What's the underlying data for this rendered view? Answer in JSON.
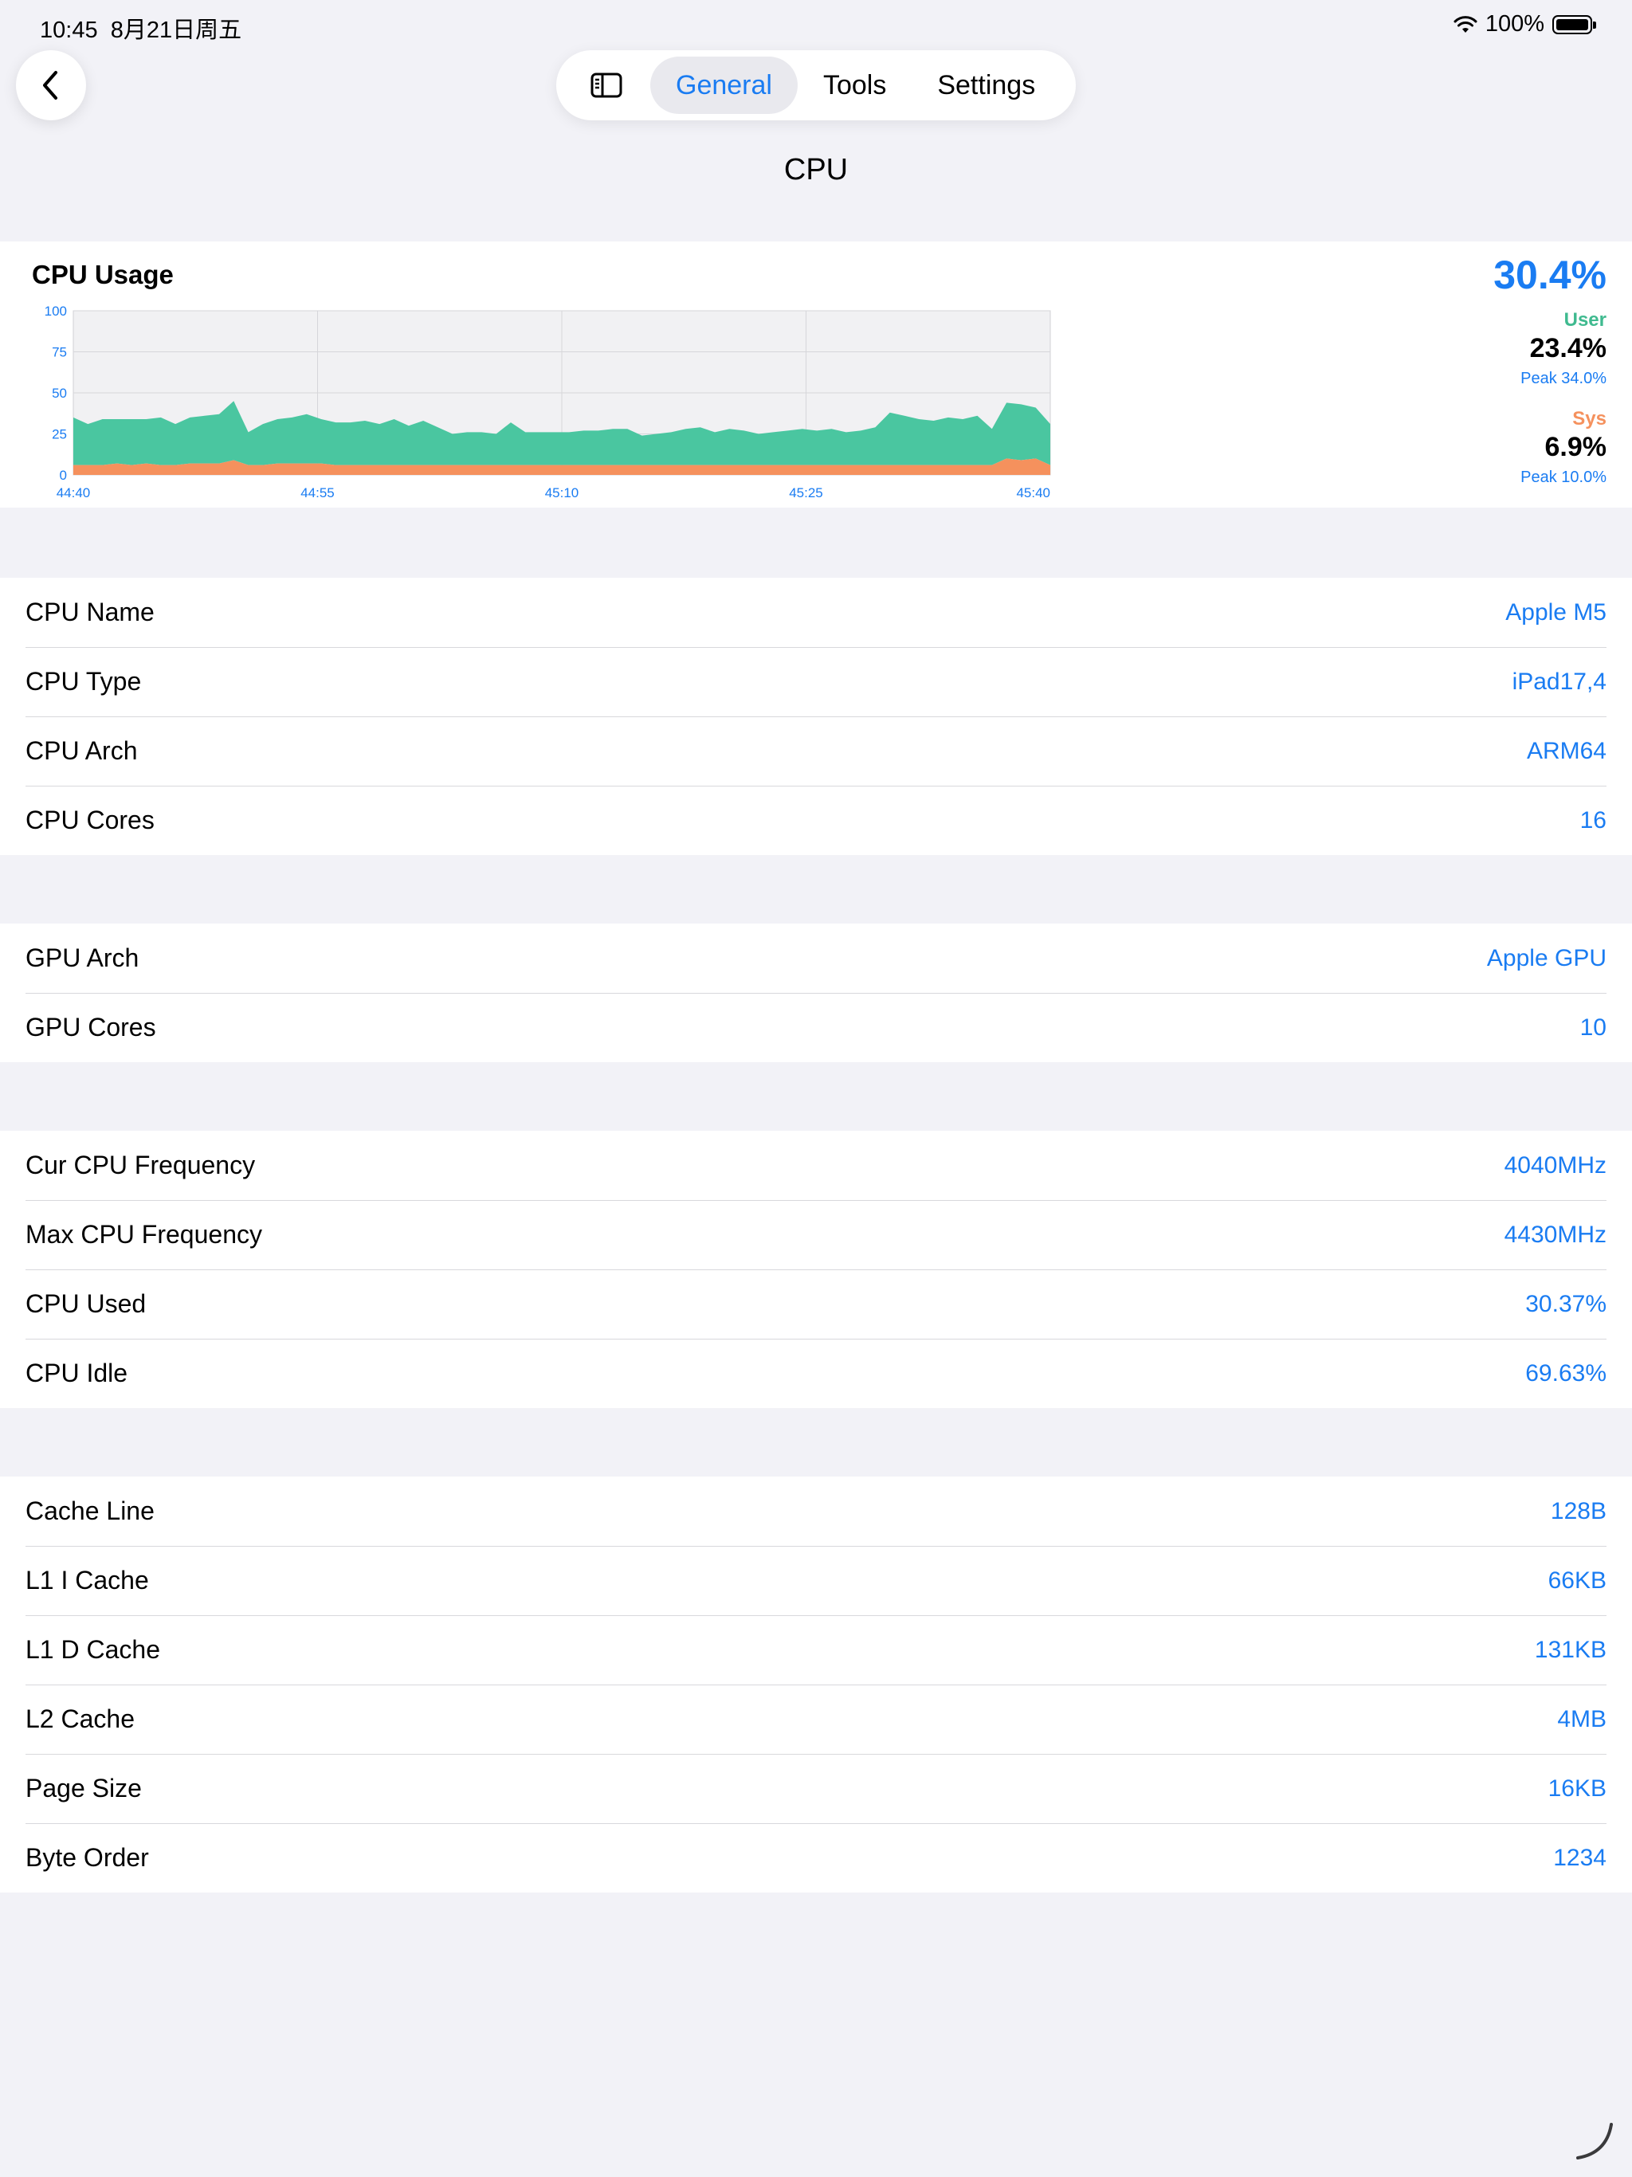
{
  "status_bar": {
    "time": "10:45",
    "date": "8月21日周五",
    "battery": "100%"
  },
  "nav": {
    "tabs": [
      {
        "label": "General",
        "active": true
      },
      {
        "label": "Tools",
        "active": false
      },
      {
        "label": "Settings",
        "active": false
      }
    ]
  },
  "page_title": "CPU",
  "cpu_usage": {
    "title": "CPU Usage",
    "total": "30.4%",
    "user_label": "User",
    "user_value": "23.4%",
    "user_peak": "Peak  34.0%",
    "sys_label": "Sys",
    "sys_value": "6.9%",
    "sys_peak": "Peak  10.0%"
  },
  "chart_data": {
    "type": "area",
    "stacked": true,
    "y_ticks": [
      "100",
      "75",
      "50",
      "25",
      "0"
    ],
    "ylim": [
      0,
      100
    ],
    "x_ticks": [
      "44:40",
      "44:55",
      "45:10",
      "45:25",
      "45:40"
    ],
    "grid": true,
    "series": [
      {
        "name": "User",
        "color": "#4ac6a0",
        "values": [
          29,
          25,
          28,
          27,
          28,
          27,
          29,
          25,
          28,
          29,
          30,
          36,
          20,
          25,
          27,
          28,
          30,
          27,
          26,
          26,
          27,
          25,
          28,
          24,
          27,
          23,
          19,
          20,
          20,
          19,
          26,
          20,
          20,
          20,
          20,
          21,
          21,
          22,
          22,
          18,
          19,
          20,
          22,
          23,
          20,
          22,
          21,
          19,
          20,
          21,
          22,
          21,
          22,
          20,
          21,
          23,
          32,
          30,
          28,
          27,
          29,
          28,
          30,
          22,
          34,
          34,
          31,
          25
        ]
      },
      {
        "name": "Sys",
        "color": "#f5915d",
        "values": [
          6,
          6,
          6,
          7,
          6,
          7,
          6,
          6,
          7,
          7,
          7,
          9,
          6,
          6,
          7,
          7,
          7,
          7,
          6,
          6,
          6,
          6,
          6,
          6,
          6,
          6,
          6,
          6,
          6,
          6,
          6,
          6,
          6,
          6,
          6,
          6,
          6,
          6,
          6,
          6,
          6,
          6,
          6,
          6,
          6,
          6,
          6,
          6,
          6,
          6,
          6,
          6,
          6,
          6,
          6,
          6,
          6,
          6,
          6,
          6,
          6,
          6,
          6,
          6,
          10,
          9,
          10,
          6
        ]
      }
    ]
  },
  "cpu_info": [
    {
      "label": "CPU Name",
      "value": "Apple M5"
    },
    {
      "label": "CPU Type",
      "value": "iPad17,4"
    },
    {
      "label": "CPU Arch",
      "value": "ARM64"
    },
    {
      "label": "CPU Cores",
      "value": "16"
    }
  ],
  "gpu_info": [
    {
      "label": "GPU Arch",
      "value": "Apple GPU"
    },
    {
      "label": "GPU Cores",
      "value": "10"
    }
  ],
  "freq_info": [
    {
      "label": "Cur CPU Frequency",
      "value": "4040MHz"
    },
    {
      "label": "Max CPU Frequency",
      "value": "4430MHz"
    },
    {
      "label": "CPU Used",
      "value": "30.37%"
    },
    {
      "label": "CPU Idle",
      "value": "69.63%"
    }
  ],
  "cache_info": [
    {
      "label": "Cache Line",
      "value": "128B"
    },
    {
      "label": "L1 I Cache",
      "value": "66KB"
    },
    {
      "label": "L1 D Cache",
      "value": "131KB"
    },
    {
      "label": "L2 Cache",
      "value": "4MB"
    },
    {
      "label": "Page Size",
      "value": "16KB"
    },
    {
      "label": "Byte Order",
      "value": "1234"
    }
  ]
}
